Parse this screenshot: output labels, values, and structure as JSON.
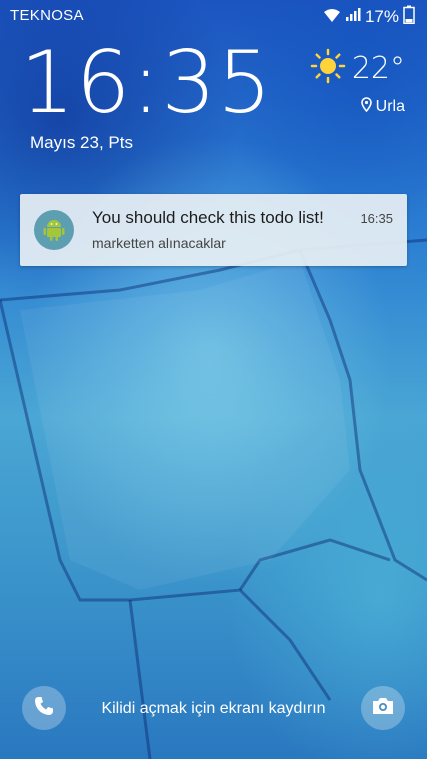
{
  "status_bar": {
    "carrier": "TEKNOSA",
    "battery_percent": "17%",
    "icons": [
      "wifi-icon",
      "signal-icon",
      "battery-icon"
    ]
  },
  "lockscreen": {
    "time": "16:35",
    "date": "Mayıs 23, Pts",
    "weather": {
      "temperature": "22°",
      "location": "Urla",
      "icon": "sun-icon"
    }
  },
  "notification": {
    "icon": "android-app-icon",
    "title": "You should check this todo list!",
    "time": "16:35",
    "body": "marketten alınacaklar"
  },
  "bottom_bar": {
    "unlock_hint": "Kilidi açmak için ekranı kaydırın",
    "left_shortcut_icon": "phone-icon",
    "right_shortcut_icon": "camera-icon"
  },
  "colors": {
    "accent": "#ffd43b",
    "notification_bg": "#e8f0f4"
  }
}
